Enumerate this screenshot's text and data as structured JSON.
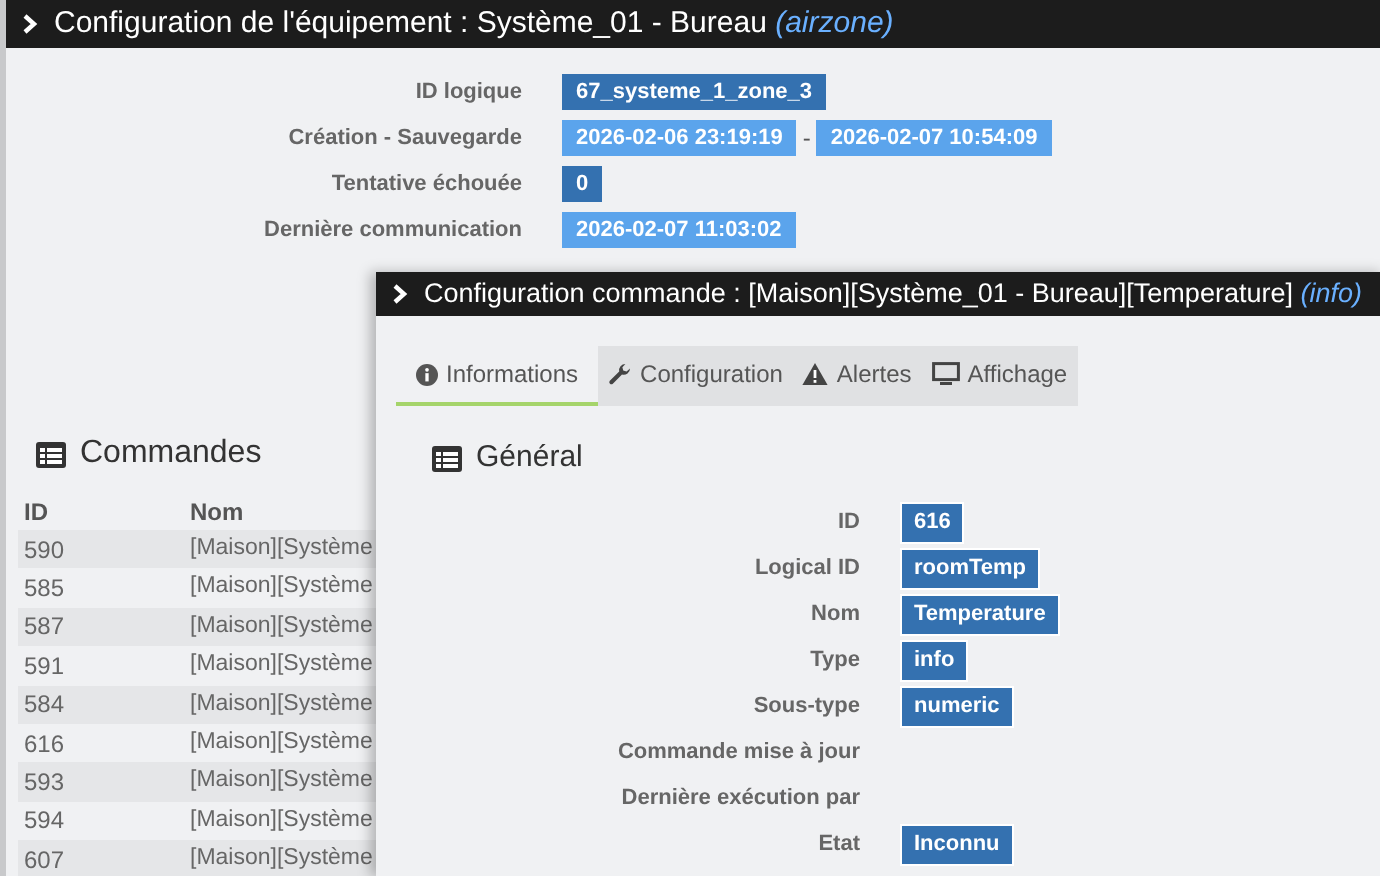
{
  "equipment_window": {
    "title": "Configuration de l'équipement : Système_01 - Bureau",
    "title_suffix": "(airzone)",
    "fields": [
      {
        "label": "ID logique",
        "values": [
          {
            "text": "67_systeme_1_zone_3",
            "kind": "primary"
          }
        ]
      },
      {
        "label": "Création - Sauvegarde",
        "separator": "-",
        "values": [
          {
            "text": "2026-02-06 23:19:19",
            "kind": "info"
          },
          {
            "text": "2026-02-07 10:54:09",
            "kind": "info"
          }
        ]
      },
      {
        "label": "Tentative échouée",
        "values": [
          {
            "text": "0",
            "kind": "primary"
          }
        ]
      },
      {
        "label": "Dernière communication",
        "values": [
          {
            "text": "2026-02-07 11:03:02",
            "kind": "info"
          }
        ]
      }
    ],
    "commands": {
      "title": "Commandes",
      "columns": [
        "ID",
        "Nom"
      ],
      "rows": [
        {
          "id": "590",
          "name": "[Maison][Système"
        },
        {
          "id": "585",
          "name": "[Maison][Système"
        },
        {
          "id": "587",
          "name": "[Maison][Système"
        },
        {
          "id": "591",
          "name": "[Maison][Système"
        },
        {
          "id": "584",
          "name": "[Maison][Système"
        },
        {
          "id": "616",
          "name": "[Maison][Système"
        },
        {
          "id": "593",
          "name": "[Maison][Système"
        },
        {
          "id": "594",
          "name": "[Maison][Système"
        },
        {
          "id": "607",
          "name": "[Maison][Système"
        }
      ]
    }
  },
  "command_window": {
    "title": "Configuration commande : [Maison][Système_01 - Bureau][Temperature]",
    "title_suffix": "(info)",
    "tabs": [
      {
        "label": "Informations",
        "selected": true
      },
      {
        "label": "Configuration",
        "selected": false
      },
      {
        "label": "Alertes",
        "selected": false
      },
      {
        "label": "Affichage",
        "selected": false
      }
    ],
    "section": "Général",
    "fields": [
      {
        "label": "ID",
        "value": "616"
      },
      {
        "label": "Logical ID",
        "value": "roomTemp"
      },
      {
        "label": "Nom",
        "value": "Temperature"
      },
      {
        "label": "Type",
        "value": "info"
      },
      {
        "label": "Sous-type",
        "value": "numeric"
      },
      {
        "label": "Commande mise à jour"
      },
      {
        "label": "Dernière exécution par"
      },
      {
        "label": "Etat",
        "value": "Inconnu"
      }
    ]
  }
}
